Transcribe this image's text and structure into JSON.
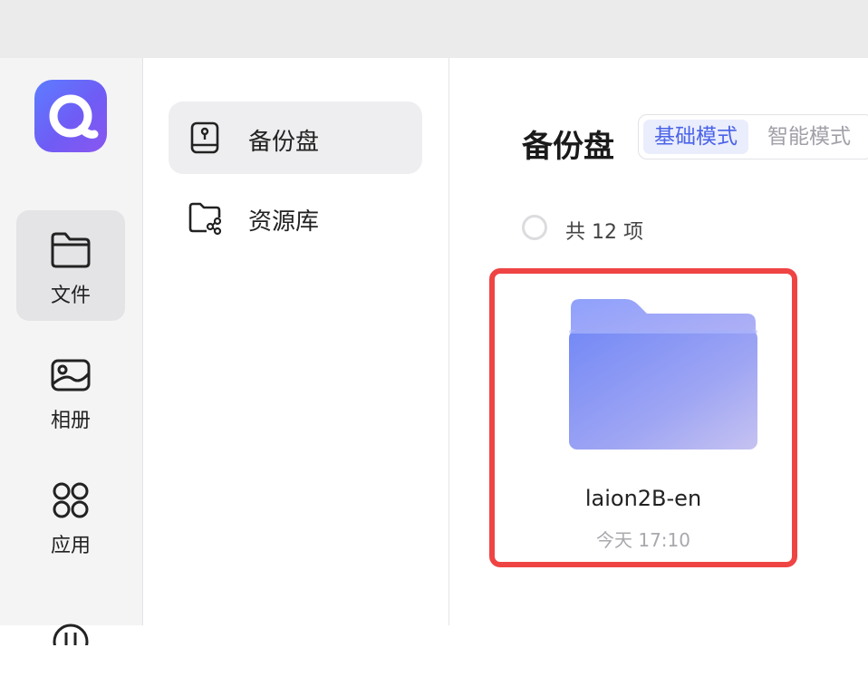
{
  "app": {
    "logo_icon": "app-logo-icon"
  },
  "rail": {
    "items": [
      {
        "label": "文件",
        "icon": "folder-icon",
        "active": true
      },
      {
        "label": "相册",
        "icon": "photo-album-icon",
        "active": false
      },
      {
        "label": "应用",
        "icon": "apps-grid-icon",
        "active": false
      },
      {
        "label": "",
        "icon": "transfer-icon",
        "active": false
      }
    ]
  },
  "nav": {
    "items": [
      {
        "label": "备份盘",
        "icon": "backup-drive-icon",
        "active": true
      },
      {
        "label": "资源库",
        "icon": "shared-folder-icon",
        "active": false
      }
    ]
  },
  "main": {
    "title": "备份盘",
    "modes": [
      {
        "label": "基础模式",
        "active": true
      },
      {
        "label": "智能模式",
        "active": false
      }
    ],
    "count_label": "共 12 项",
    "files": [
      {
        "name": "laion2B-en",
        "time": "今天 17:10",
        "icon": "folder-icon",
        "highlighted": true
      }
    ]
  },
  "colors": {
    "accent": "#4a63e8",
    "highlight_border": "#ef4444",
    "folder": "#7d8cf8"
  }
}
